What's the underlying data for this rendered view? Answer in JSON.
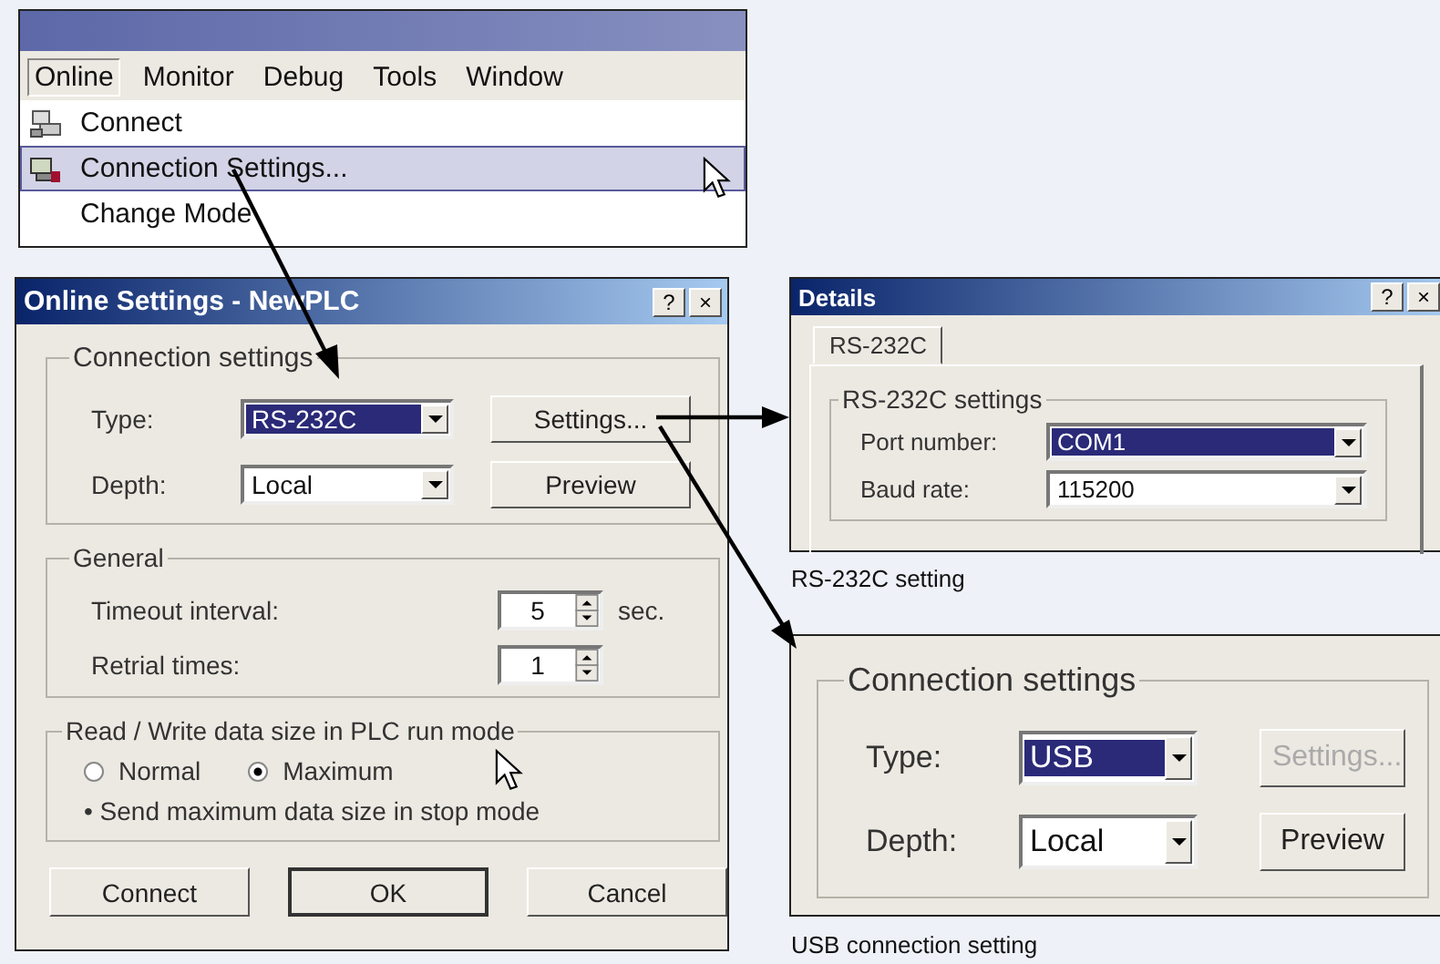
{
  "menu_window": {
    "menu_bar": [
      {
        "label": "Online",
        "selected": true
      },
      {
        "label": "Monitor",
        "selected": false
      },
      {
        "label": "Debug",
        "selected": false
      },
      {
        "label": "Tools",
        "selected": false
      },
      {
        "label": "Window",
        "selected": false
      }
    ],
    "menu_items": [
      {
        "label": "Connect",
        "kind": "connect",
        "selected": false
      },
      {
        "label": "Connection Settings...",
        "kind": "settings",
        "selected": true
      },
      {
        "label": "Change Mode",
        "kind": "none",
        "selected": false
      }
    ]
  },
  "online_settings": {
    "title": "Online Settings - NewPLC",
    "help": "?",
    "close": "×",
    "connection_settings": {
      "legend": "Connection settings",
      "type_label": "Type:",
      "type_value": "RS-232C",
      "type_selected": true,
      "depth_label": "Depth:",
      "depth_value": "Local",
      "depth_selected": false,
      "settings_button": {
        "label": "Settings...",
        "disabled": false
      },
      "preview_button": {
        "label": "Preview",
        "disabled": false
      }
    },
    "general": {
      "legend": "General",
      "timeout_label": "Timeout interval:",
      "timeout_value": "5",
      "timeout_unit": "sec.",
      "retrial_label": "Retrial times:",
      "retrial_value": "1"
    },
    "run_mode": {
      "legend": "Read / Write data size in PLC run mode",
      "options": [
        {
          "label": "Normal",
          "selected": false
        },
        {
          "label": "Maximum",
          "selected": true
        }
      ],
      "note": "• Send maximum data size in stop mode"
    },
    "buttons": [
      "Connect",
      "OK",
      "Cancel"
    ]
  },
  "details": {
    "title": "Details",
    "help": "?",
    "close": "×",
    "tabs": [
      {
        "label": "RS-232C",
        "selected": true
      }
    ],
    "legend": "RS-232C settings",
    "fields": [
      {
        "label": "Port number:",
        "value": "COM1",
        "selected": true
      },
      {
        "label": "Baud rate:",
        "value": "115200",
        "selected": false
      }
    ]
  },
  "details_caption": "RS-232C setting",
  "usb": {
    "legend": "Connection settings",
    "type_label": "Type:",
    "type_value": "USB",
    "type_selected": true,
    "depth_label": "Depth:",
    "depth_value": "Local",
    "depth_selected": false,
    "settings_button": {
      "label": "Settings...",
      "disabled": true
    },
    "preview_button": {
      "label": "Preview",
      "disabled": false
    }
  },
  "usb_caption": "USB connection setting"
}
